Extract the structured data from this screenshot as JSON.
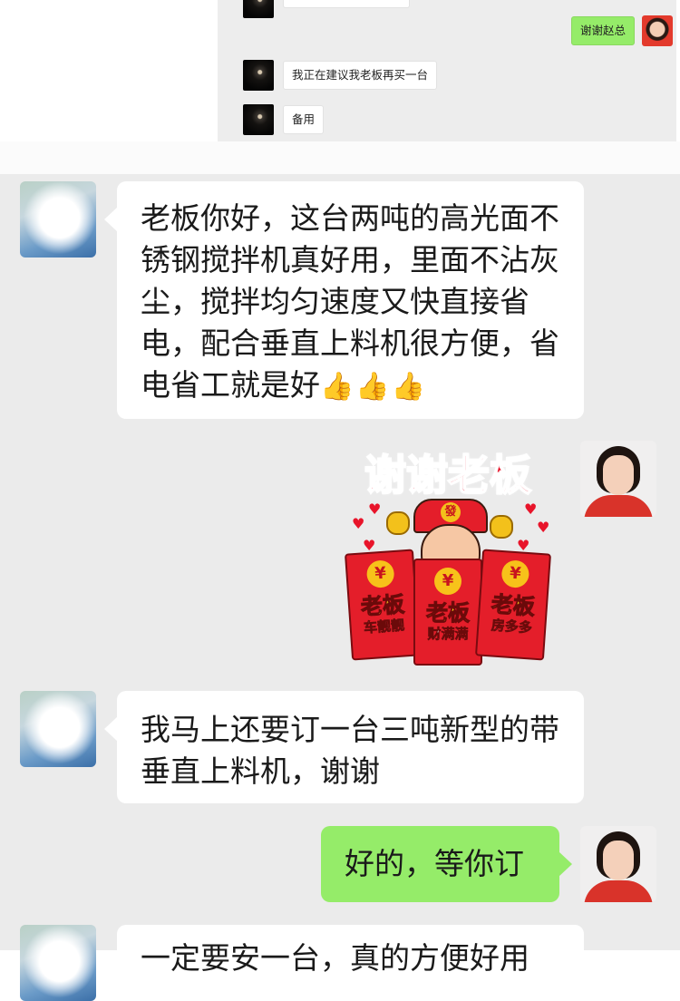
{
  "inset": {
    "messages": [
      {
        "side": "right",
        "text": "谢谢赵总"
      },
      {
        "side": "left",
        "text": "我正在建议我老板再买一台"
      },
      {
        "side": "left",
        "text": "备用"
      }
    ]
  },
  "chat": {
    "messages": [
      {
        "side": "left",
        "text": "老板你好，这台两吨的高光面不锈钢搅拌机真好用，里面不沾灰尘，搅拌均匀速度又快直接省电，配合垂直上料机很方便，省电省工就是好",
        "emoji": "👍👍👍"
      },
      {
        "side": "right",
        "type": "sticker"
      },
      {
        "side": "left",
        "text": "我马上还要订一台三吨新型的带垂直上料机，谢谢"
      },
      {
        "side": "right",
        "text": "好的，等你订"
      }
    ],
    "sticker": {
      "title": "谢谢老板",
      "envelopes": [
        {
          "coin": "¥",
          "big": "老板",
          "small": "车靓靓"
        },
        {
          "coin": "¥",
          "big": "老板",
          "small": "财满满"
        },
        {
          "coin": "¥",
          "big": "老板",
          "small": "房多多"
        }
      ],
      "hat_badge": "發"
    },
    "partial_text": "一定要安一台，真的方便好用"
  }
}
